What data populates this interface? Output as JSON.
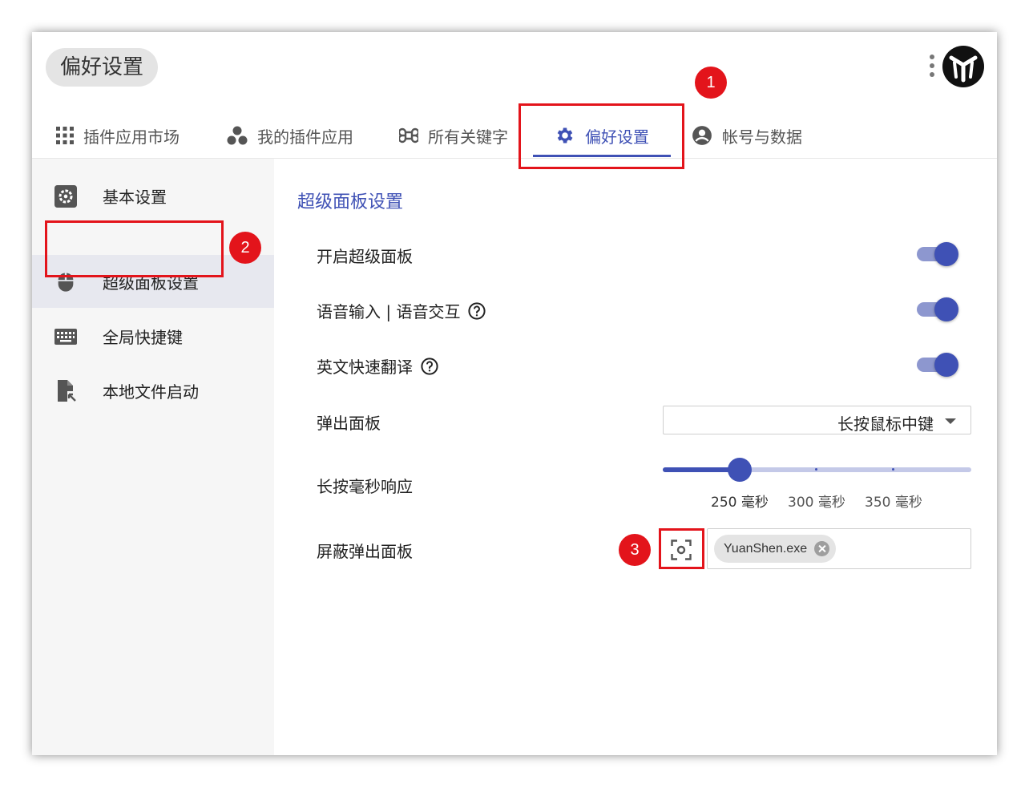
{
  "window": {
    "title": "偏好设置"
  },
  "tabs": [
    {
      "label": "插件应用市场",
      "icon": "apps-grid-icon"
    },
    {
      "label": "我的插件应用",
      "icon": "bubbles-icon"
    },
    {
      "label": "所有关键字",
      "icon": "command-key-icon"
    },
    {
      "label": "偏好设置",
      "icon": "gear-icon",
      "active": true
    },
    {
      "label": "帐号与数据",
      "icon": "account-circle-icon"
    }
  ],
  "sidebar": {
    "items": [
      {
        "label": "基本设置",
        "icon": "settings-box-icon"
      },
      {
        "label": "超级面板设置",
        "icon": "mouse-icon",
        "active": true
      },
      {
        "label": "全局快捷键",
        "icon": "keyboard-icon"
      },
      {
        "label": "本地文件启动",
        "icon": "file-launch-icon"
      }
    ]
  },
  "main": {
    "section_title": "超级面板设置",
    "rows": {
      "enable_panel": {
        "label": "开启超级面板",
        "on": true
      },
      "voice": {
        "label": "语音输入 | 语音交互",
        "on": true
      },
      "translate": {
        "label": "英文快速翻译",
        "on": true
      },
      "popup": {
        "label": "弹出面板",
        "selected": "长按鼠标中键"
      },
      "long_press": {
        "label": "长按毫秒响应",
        "marks": [
          "250 毫秒",
          "300 毫秒",
          "350 毫秒"
        ],
        "min": 200,
        "max": 400,
        "value": 250
      },
      "block": {
        "label": "屏蔽弹出面板",
        "chips": [
          "YuanShen.exe"
        ]
      }
    }
  },
  "annotations": [
    "1",
    "2",
    "3"
  ],
  "colors": {
    "accent": "#3f51b5",
    "annotation": "#e3141b"
  }
}
